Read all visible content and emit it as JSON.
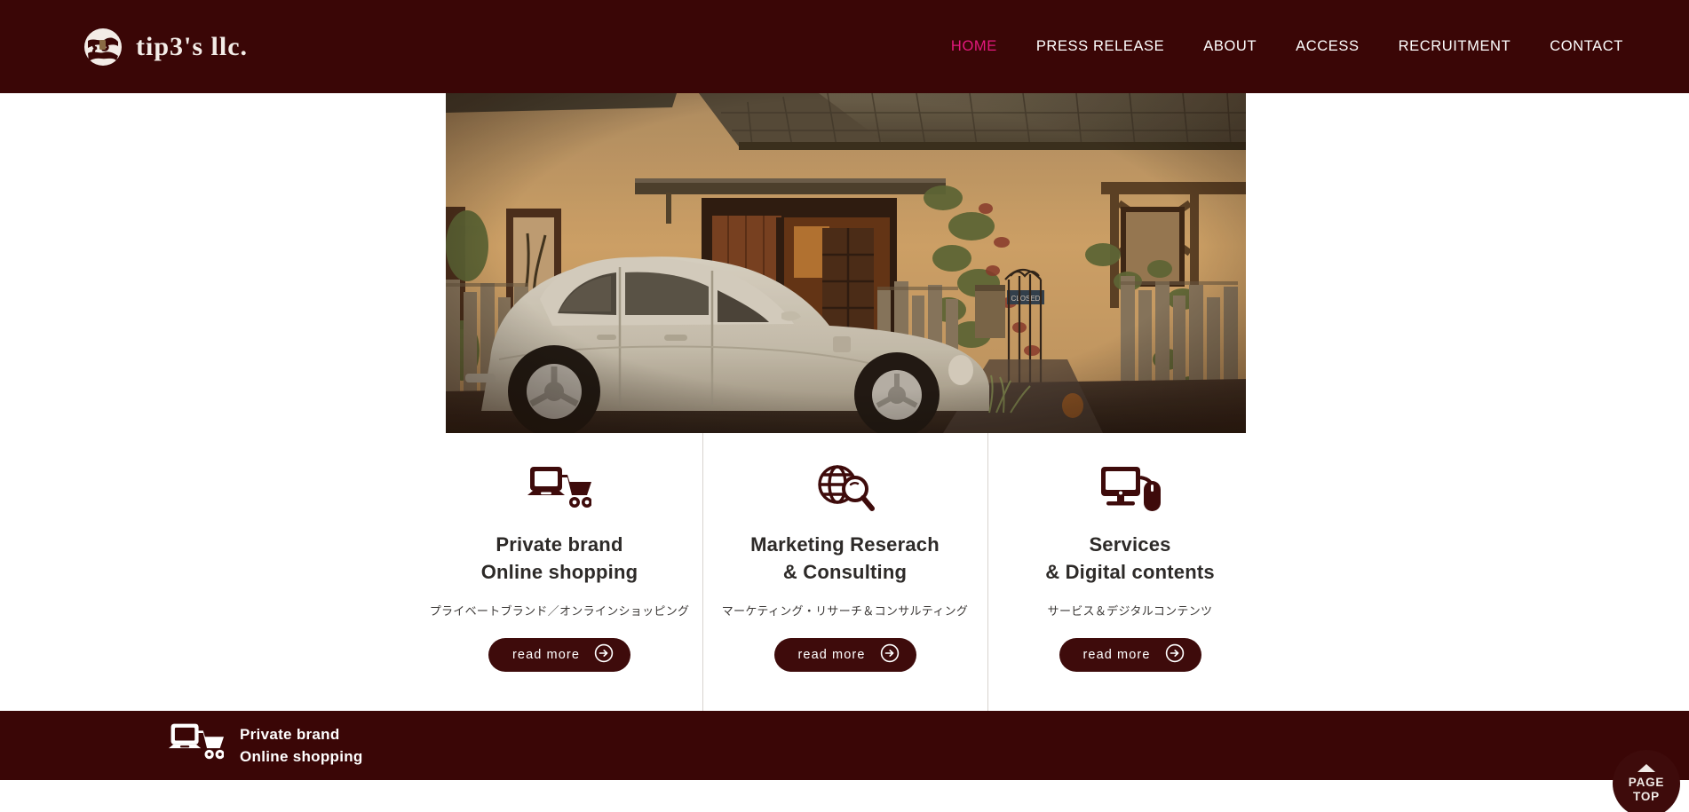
{
  "site": {
    "logo_text": "tip3's llc.",
    "logo_icon": "circle-3s-monogram-icon",
    "brand_color": "#3a0606",
    "accent_color": "#e5187f",
    "button_color": "#3e0b0b"
  },
  "nav": {
    "items": [
      {
        "label": "HOME",
        "active": true
      },
      {
        "label": "PRESS RELEASE",
        "active": false
      },
      {
        "label": "ABOUT",
        "active": false
      },
      {
        "label": "ACCESS",
        "active": false
      },
      {
        "label": "RECRUITMENT",
        "active": false
      },
      {
        "label": "CONTACT",
        "active": false
      }
    ]
  },
  "hero": {
    "alt": "Vintage cream Volkswagen Beetle parked in front of a stucco house with tiled roof, wooden fence, climbing vines and an iron gate at sunset",
    "image_name": "hero-photo-vw-beetle"
  },
  "services": {
    "columns": [
      {
        "icon": "laptop-shopping-cart-icon",
        "title_line1": "Private brand",
        "title_line2": "Online shopping",
        "subtitle": "プライベートブランド／オンラインショッピング",
        "button_label": "read more"
      },
      {
        "icon": "globe-magnifier-icon",
        "title_line1": "Marketing Reserach",
        "title_line2": "& Consulting",
        "subtitle": "マーケティング・リサーチ＆コンサルティング",
        "button_label": "read more"
      },
      {
        "icon": "monitor-mouse-icon",
        "title_line1": "Services",
        "title_line2": "& Digital contents",
        "subtitle": "サービス＆デジタルコンテンツ",
        "button_label": "read more"
      }
    ]
  },
  "bottom_bar": {
    "icon": "laptop-shopping-cart-icon",
    "line1": "Private brand",
    "line2": "Online shopping"
  },
  "page_top": {
    "icon": "triangle-up-icon",
    "line1": "PAGE",
    "line2": "TOP"
  }
}
